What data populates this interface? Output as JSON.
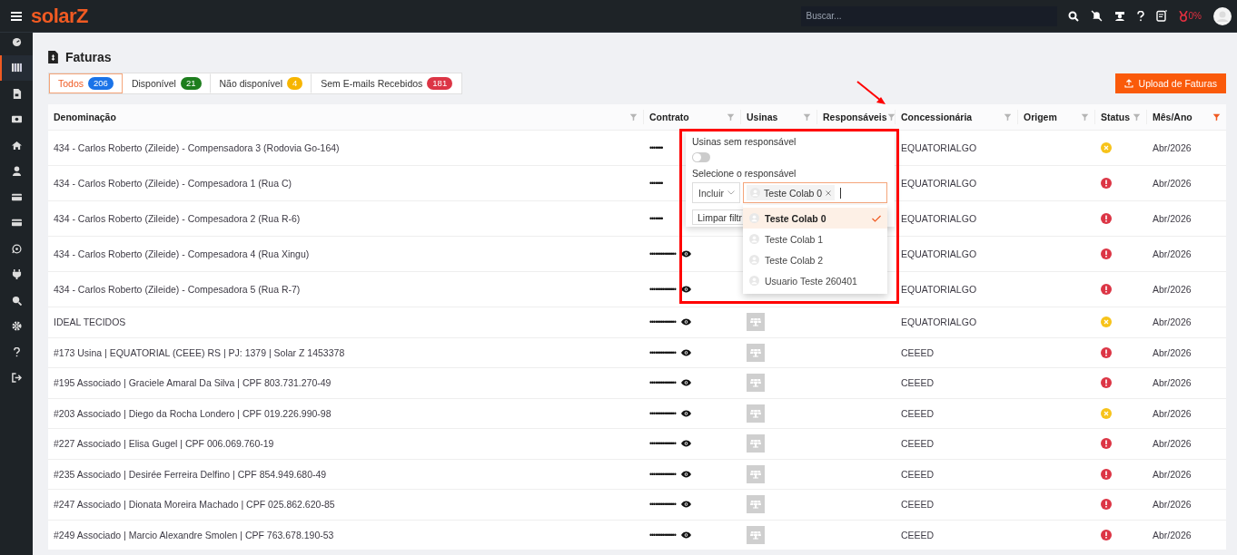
{
  "topbar": {
    "logo": "solarZ",
    "search": {
      "placeholder": "Buscar..."
    },
    "score": "0%"
  },
  "sidebar": {
    "items": [
      {
        "kind": "dashboard",
        "selected": false
      },
      {
        "kind": "columns",
        "selected": true
      },
      {
        "kind": "document",
        "selected": false
      },
      {
        "kind": "money",
        "selected": false
      },
      {
        "kind": "home",
        "selected": false
      },
      {
        "kind": "user",
        "selected": false
      },
      {
        "kind": "card",
        "selected": false
      },
      {
        "kind": "card",
        "selected": false
      },
      {
        "kind": "chat",
        "selected": false
      },
      {
        "kind": "plug",
        "selected": false
      },
      {
        "kind": "search",
        "selected": false
      },
      {
        "kind": "gear",
        "selected": false
      },
      {
        "kind": "help",
        "selected": false
      },
      {
        "kind": "logout",
        "selected": false
      }
    ]
  },
  "page": {
    "title": "Faturas",
    "upload_button": "Upload de Faturas"
  },
  "tabs": [
    {
      "label": "Todos",
      "count": "206",
      "color": "#1a73e8",
      "selected": true
    },
    {
      "label": "Disponível",
      "count": "21",
      "color": "#1e7e1e",
      "selected": false
    },
    {
      "label": "Não disponível",
      "count": "4",
      "color": "#f7b500",
      "selected": false
    },
    {
      "label": "Sem E-mails Recebidos",
      "count": "181",
      "color": "#dc3545",
      "selected": false
    }
  ],
  "table": {
    "columns": [
      {
        "label": "Denominação",
        "filter_active": false
      },
      {
        "label": "Contrato",
        "filter_active": false
      },
      {
        "label": "Usinas",
        "filter_active": false
      },
      {
        "label": "Responsáveis",
        "filter_active": false
      },
      {
        "label": "Concessionária",
        "filter_active": false
      },
      {
        "label": "Origem",
        "filter_active": false
      },
      {
        "label": "Status",
        "filter_active": false
      },
      {
        "label": "Mês/Ano",
        "filter_active": true
      }
    ],
    "rows": [
      {
        "name": "434 - Carlos Roberto (Zileide) - Compensadora 3 (Rodovia Go-164)",
        "contract": "•••••••",
        "eye": false,
        "plant_thumb": false,
        "utility": "EQUATORIALGO",
        "status": {
          "kind": "warning"
        },
        "month": "Abr/2026"
      },
      {
        "name": "434 - Carlos Roberto (Zileide) - Compesadora 1 (Rua C)",
        "contract": "•••••••",
        "eye": false,
        "plant_thumb": false,
        "utility": "EQUATORIALGO",
        "status": {
          "kind": "error"
        },
        "month": "Abr/2026"
      },
      {
        "name": "434 - Carlos Roberto (Zileide) - Compesadora 2 (Rua R-6)",
        "contract": "•••••••",
        "eye": false,
        "plant_thumb": false,
        "utility": "EQUATORIALGO",
        "status": {
          "kind": "error"
        },
        "month": "Abr/2026"
      },
      {
        "name": "434 - Carlos Roberto (Zileide) - Compesadora 4 (Rua Xingu)",
        "contract": "••••••••••••••",
        "eye": true,
        "plant_thumb": false,
        "utility": "EQUATORIALGO",
        "status": {
          "kind": "error"
        },
        "month": "Abr/2026"
      },
      {
        "name": "434 - Carlos Roberto (Zileide) - Compesadora 5 (Rua R-7)",
        "contract": "••••••••••••••",
        "eye": true,
        "plant_thumb": false,
        "utility": "EQUATORIALGO",
        "status": {
          "kind": "error"
        },
        "month": "Abr/2026"
      },
      {
        "name": "IDEAL TECIDOS",
        "contract": "••••••••••••••",
        "eye": true,
        "plant_thumb": true,
        "utility": "EQUATORIALGO",
        "status": {
          "kind": "warning"
        },
        "month": "Abr/2026"
      },
      {
        "name": "#173 Usina | EQUATORIAL (CEEE) RS | PJ: 1379 | Solar Z 1453378",
        "contract": "••••••••••••••",
        "eye": true,
        "plant_thumb": true,
        "utility": "CEEED",
        "status": {
          "kind": "error"
        },
        "month": "Abr/2026"
      },
      {
        "name": "#195 Associado | Graciele Amaral Da Silva | CPF 803.731.270-49",
        "contract": "••••••••••••••",
        "eye": true,
        "plant_thumb": true,
        "utility": "CEEED",
        "status": {
          "kind": "error"
        },
        "month": "Abr/2026"
      },
      {
        "name": "#203 Associado | Diego da Rocha Londero | CPF 019.226.990-98",
        "contract": "••••••••••••••",
        "eye": true,
        "plant_thumb": true,
        "utility": "CEEED",
        "status": {
          "kind": "warning"
        },
        "month": "Abr/2026"
      },
      {
        "name": "#227 Associado | Elisa Gugel | CPF 006.069.760-19",
        "contract": "••••••••••••••",
        "eye": true,
        "plant_thumb": true,
        "utility": "CEEED",
        "status": {
          "kind": "error"
        },
        "month": "Abr/2026"
      },
      {
        "name": "#235 Associado | Desirée Ferreira Delfino | CPF 854.949.680-49",
        "contract": "••••••••••••••",
        "eye": true,
        "plant_thumb": true,
        "utility": "CEEED",
        "status": {
          "kind": "error"
        },
        "month": "Abr/2026"
      },
      {
        "name": "#247 Associado | Dionata Moreira Machado | CPF 025.862.620-85",
        "contract": "••••••••••••••",
        "eye": true,
        "plant_thumb": true,
        "utility": "CEEED",
        "status": {
          "kind": "error"
        },
        "month": "Abr/2026"
      },
      {
        "name": "#249 Associado | Marcio Alexandre Smolen | CPF 763.678.190-53",
        "contract": "••••••••••••••",
        "eye": true,
        "plant_thumb": true,
        "utility": "CEEED",
        "status": {
          "kind": "error"
        },
        "month": "Abr/2026"
      }
    ]
  },
  "filter_popup": {
    "toggle_label": "Usinas sem responsável",
    "toggle": {
      "on": false
    },
    "select_label": "Selecione o responsável",
    "mode": "Incluir",
    "chip": "Teste Colab 0",
    "clear_button": "Limpar filtr",
    "options": [
      {
        "label": "Teste Colab 0",
        "selected": true
      },
      {
        "label": "Teste Colab 1",
        "selected": false
      },
      {
        "label": "Teste Colab 2",
        "selected": false
      },
      {
        "label": "Usuario Teste 260401",
        "selected": false
      }
    ]
  }
}
